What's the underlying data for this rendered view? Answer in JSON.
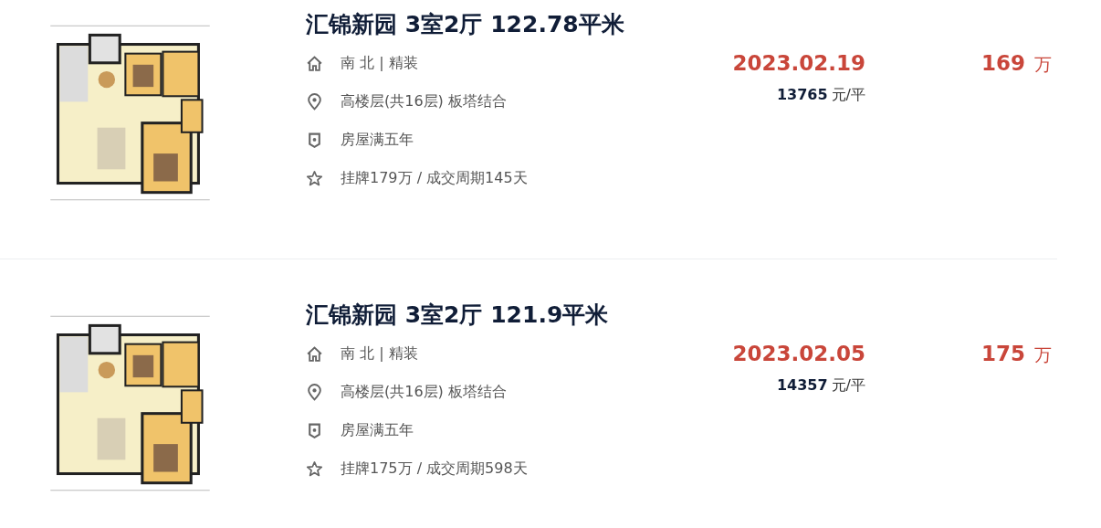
{
  "listings": [
    {
      "title": "汇锦新园 3室2厅 122.78平米",
      "orientation": "南 北 | 精装",
      "floor": "高楼层(共16层) 板塔结合",
      "tag": "房屋满五年",
      "history": "挂牌179万 / 成交周期145天",
      "deal_date": "2023.02.19",
      "unit_price": "13765",
      "unit_price_unit": "元/平",
      "total_price": "169",
      "total_price_unit": "万"
    },
    {
      "title": "汇锦新园 3室2厅 121.9平米",
      "orientation": "南 北 | 精装",
      "floor": "高楼层(共16层) 板塔结合",
      "tag": "房屋满五年",
      "history": "挂牌175万 / 成交周期598天",
      "deal_date": "2023.02.05",
      "unit_price": "14357",
      "unit_price_unit": "元/平",
      "total_price": "175",
      "total_price_unit": "万"
    }
  ]
}
